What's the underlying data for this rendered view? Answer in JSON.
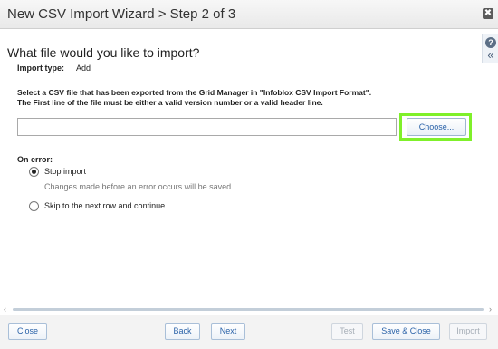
{
  "window": {
    "title": "New CSV Import Wizard > Step 2 of 3",
    "close_glyph": "✖"
  },
  "side_tools": {
    "help_glyph": "?",
    "collapse_glyph": "«"
  },
  "main": {
    "heading": "What file would you like to import?",
    "import_type_label": "Import type:",
    "import_type_value": "Add",
    "instruction_line1": "Select a CSV file that has been exported from the Grid Manager in \"Infoblox CSV Import Format\".",
    "instruction_line2": "The First line of the file must be either a valid version number or a valid header line.",
    "file_path_value": "",
    "choose_button": "Choose...",
    "on_error_label": "On error:",
    "options": {
      "stop_label": "Stop import",
      "stop_hint": "Changes made before an error occurs will be saved",
      "skip_label": "Skip to the next row and continue",
      "selected": "stop"
    }
  },
  "scrollbar": {
    "left_glyph": "‹",
    "right_glyph": "›"
  },
  "footer": {
    "close": "Close",
    "back": "Back",
    "next": "Next",
    "test": "Test",
    "save_close": "Save & Close",
    "import": "Import"
  },
  "colors": {
    "highlight": "#7ff02a",
    "link_blue": "#2a62a8"
  },
  "icons": [
    "close-icon",
    "help-icon",
    "collapse-icon",
    "scroll-left-icon",
    "scroll-right-icon"
  ]
}
